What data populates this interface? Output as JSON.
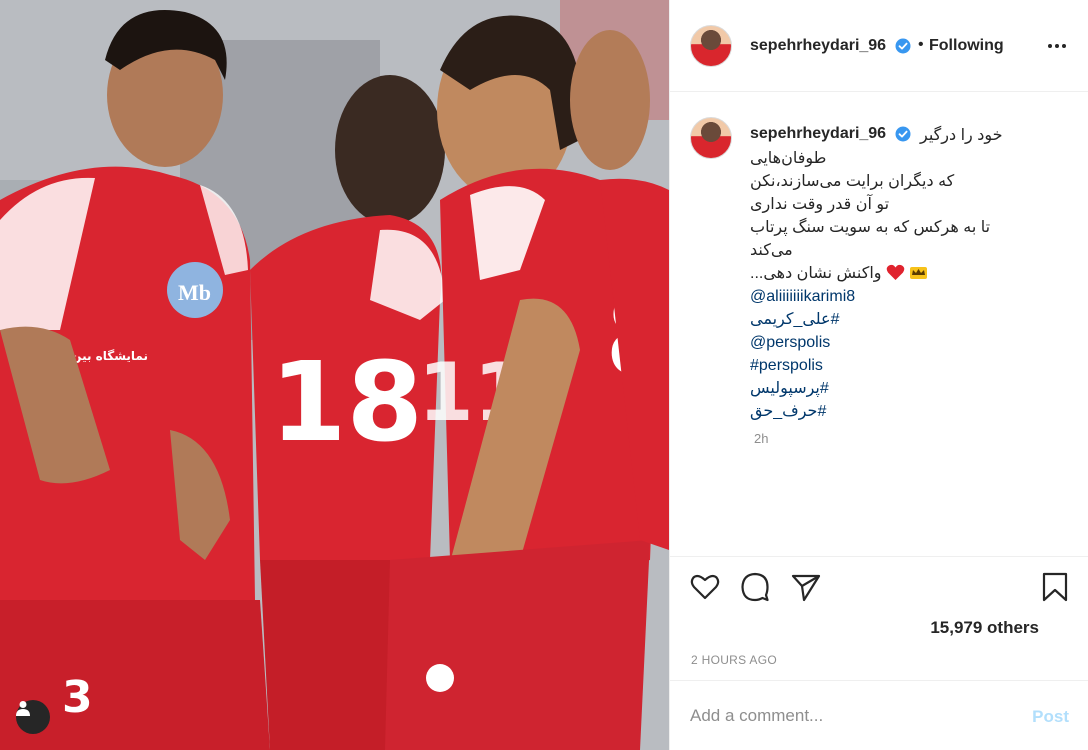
{
  "post": {
    "username": "sepehrheydari_96",
    "follow_separator": "•",
    "follow_status": "Following",
    "caption_lines": [
      "خود را درگیر",
      "طوفان‌هایی",
      "که دیگران برایت می‌سازند،نکن",
      "تو آن قدر وقت نداری",
      "تا به هرکس که به سویت سنگ پرتاب",
      "می‌کند",
      "واکنش نشان دهی..."
    ],
    "mentions_and_tags": [
      "@aliiiiiiikarimi8",
      "#علی_کریمی",
      "@perspolis",
      "#perspolis",
      "#پرسپولیس",
      "#حرف_حق"
    ],
    "relative_time": "2h",
    "likes_text": "15,979 others",
    "posted_time": "2 HOURS AGO",
    "comment_placeholder": "Add a comment...",
    "post_button_label": "Post"
  },
  "photo": {
    "jersey_numbers": [
      "18",
      "8",
      "3",
      "11"
    ],
    "sponsor_text": "نمایشگاه بین المللی"
  },
  "colors": {
    "link": "#00376b",
    "verified": "#3897f0",
    "heart_emoji": "#e0232e",
    "crown_emoji": "#f7c21a",
    "post_button_disabled": "#b2dffc",
    "jersey_red": "#d92530"
  },
  "icons": {
    "like": "heart-outline-icon",
    "comment": "comment-bubble-icon",
    "share": "paper-plane-icon",
    "save": "bookmark-icon",
    "more": "more-options-icon",
    "verified": "verified-badge-icon",
    "tag": "user-tag-icon"
  }
}
